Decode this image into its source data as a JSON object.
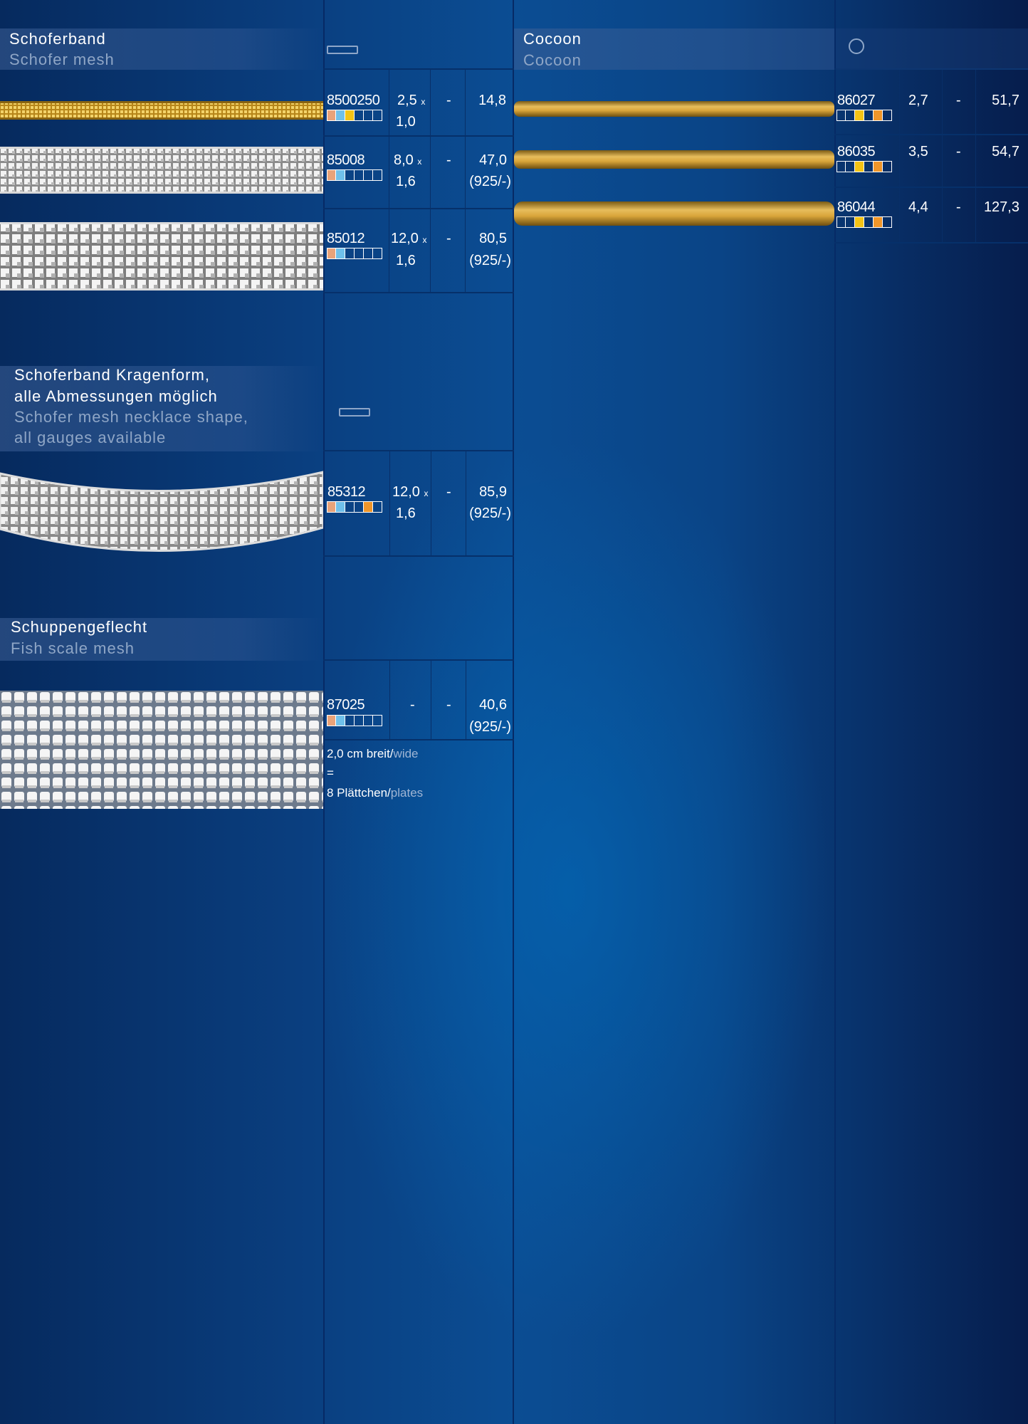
{
  "sections": {
    "schoferband": {
      "title_de": "Schoferband",
      "title_en": "Schofer mesh",
      "shape_icon": "rectangle-profile-icon",
      "items": [
        {
          "code": "8500250",
          "dim1": "2,5",
          "x": "x",
          "dim2": "1,0",
          "dash": "-",
          "price": "14,8",
          "alloy": "",
          "swatches": [
            "#e8a37a",
            "#6fc0ea",
            "#f4c315",
            "",
            "",
            ""
          ]
        },
        {
          "code": "85008",
          "dim1": "8,0",
          "x": "x",
          "dim2": "1,6",
          "dash": "-",
          "price": "47,0",
          "alloy": "(925/-)",
          "swatches": [
            "#e8a37a",
            "#6fc0ea",
            "",
            "",
            "",
            ""
          ]
        },
        {
          "code": "85012",
          "dim1": "12,0",
          "x": "x",
          "dim2": "1,6",
          "dash": "-",
          "price": "80,5",
          "alloy": "(925/-)",
          "swatches": [
            "#e8a37a",
            "#6fc0ea",
            "",
            "",
            "",
            ""
          ]
        }
      ]
    },
    "kragen": {
      "title_de_1": "Schoferband Kragenform,",
      "title_de_2": "alle Abmessungen möglich",
      "title_en_1": "Schofer mesh necklace shape,",
      "title_en_2": "all gauges available",
      "shape_icon": "rectangle-profile-icon",
      "items": [
        {
          "code": "85312",
          "dim1": "12,0",
          "x": "x",
          "dim2": "1,6",
          "dash": "-",
          "price": "85,9",
          "alloy": "(925/-)",
          "swatches": [
            "#e8a37a",
            "#6fc0ea",
            "",
            "",
            "#f0962a",
            ""
          ]
        }
      ]
    },
    "schuppen": {
      "title_de": "Schuppengeflecht",
      "title_en": "Fish scale mesh",
      "items": [
        {
          "code": "87025",
          "dim1": "-",
          "dash": "-",
          "price": "40,6",
          "alloy": "(925/-)",
          "swatches": [
            "#e8a37a",
            "#6fc0ea",
            "",
            "",
            "",
            ""
          ]
        }
      ],
      "note_line1_de": "2,0 cm breit/",
      "note_line1_en": "wide",
      "note_line2": "=",
      "note_line3_de": "8 Plättchen/",
      "note_line3_en": "plates"
    },
    "cocoon": {
      "title_de": "Cocoon",
      "title_en": "Cocoon",
      "shape_icon": "circle-profile-icon",
      "items": [
        {
          "code": "86027",
          "dim1": "2,7",
          "dash": "-",
          "price": "51,7",
          "swatches": [
            "",
            "",
            "#f4c315",
            "",
            "#f0962a",
            ""
          ]
        },
        {
          "code": "86035",
          "dim1": "3,5",
          "dash": "-",
          "price": "54,7",
          "swatches": [
            "",
            "",
            "#f4c315",
            "",
            "#f0962a",
            ""
          ]
        },
        {
          "code": "86044",
          "dim1": "4,4",
          "dash": "-",
          "price": "127,3",
          "swatches": [
            "",
            "",
            "#f4c315",
            "",
            "#f0962a",
            ""
          ]
        }
      ]
    }
  }
}
